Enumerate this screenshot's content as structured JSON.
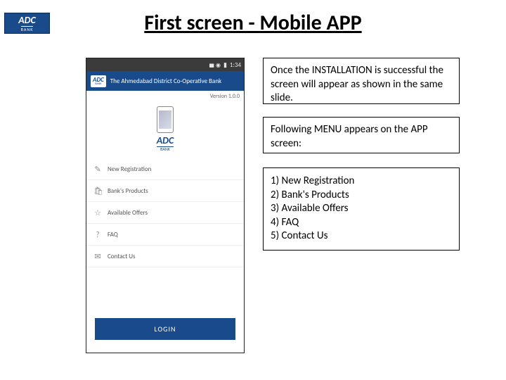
{
  "title": "First screen - Mobile APP",
  "logo": {
    "name": "ADC",
    "sub": "BANK"
  },
  "phone": {
    "status": {
      "time": "1:34"
    },
    "header": {
      "bank_name": "The Ahmedabad District Co-Operative Bank"
    },
    "version": "Version 1.0.0",
    "hero_logo": {
      "name": "ADC",
      "sub": "BANK"
    },
    "menu": [
      {
        "icon": "✎",
        "label": "New Registration"
      },
      {
        "icon": "🛍",
        "label": "Bank's Products"
      },
      {
        "icon": "☆",
        "label": "Available Offers"
      },
      {
        "icon": "?",
        "label": "FAQ"
      },
      {
        "icon": "✉",
        "label": "Contact Us"
      }
    ],
    "login": "LOGIN"
  },
  "box1": "Once the INSTALLATION is successful the screen will appear as shown in the same slide.",
  "box2": "Following MENU appears on the APP screen:",
  "box3": {
    "items": [
      "1) New Registration",
      "2) Bank's Products",
      "3) Available Offers",
      "4) FAQ",
      "5) Contact Us"
    ]
  }
}
